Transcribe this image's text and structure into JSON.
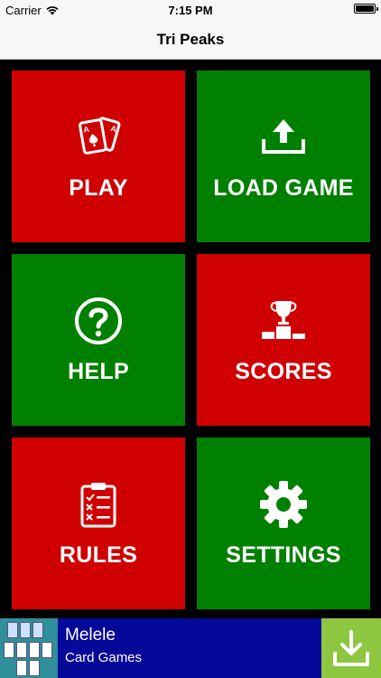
{
  "status_bar": {
    "carrier": "Carrier",
    "time": "7:15 PM",
    "battery_level": 1.0
  },
  "nav": {
    "title": "Tri Peaks"
  },
  "colors": {
    "red": "#d00000",
    "green": "#008000",
    "ad_background": "#050899",
    "ad_download": "#8dc63f"
  },
  "menu": {
    "play": {
      "label": "PLAY",
      "icon": "playing-cards-icon",
      "color": "red"
    },
    "load_game": {
      "label": "LOAD GAME",
      "icon": "upload-icon",
      "color": "green"
    },
    "help": {
      "label": "HELP",
      "icon": "question-icon",
      "color": "green"
    },
    "scores": {
      "label": "SCORES",
      "icon": "trophy-podium-icon",
      "color": "red"
    },
    "rules": {
      "label": "RULES",
      "icon": "clipboard-checklist-icon",
      "color": "red"
    },
    "settings": {
      "label": "SETTINGS",
      "icon": "gear-icon",
      "color": "green"
    }
  },
  "ad": {
    "title": "Melele",
    "subtitle": "Card Games",
    "download_icon": "download-icon"
  }
}
